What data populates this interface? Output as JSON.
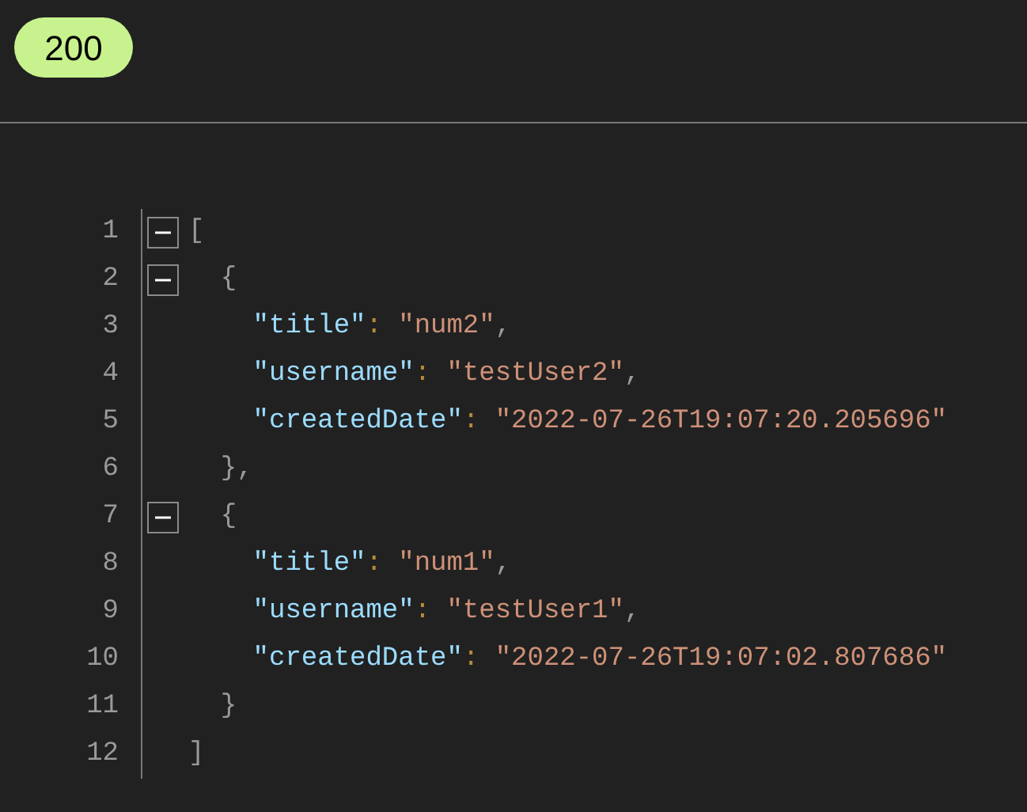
{
  "status": "200",
  "lines": [
    {
      "number": "1",
      "expanded": true,
      "tokens": [
        {
          "kind": "punct",
          "text": "["
        }
      ]
    },
    {
      "number": "2",
      "expanded": true,
      "tokens": [
        {
          "kind": "punct",
          "text": "  {"
        }
      ]
    },
    {
      "number": "3",
      "tokens": [
        {
          "kind": "key",
          "text": "    \"title\""
        },
        {
          "kind": "colon",
          "text": ": "
        },
        {
          "kind": "string",
          "text": "\"num2\""
        },
        {
          "kind": "punct",
          "text": ","
        }
      ]
    },
    {
      "number": "4",
      "tokens": [
        {
          "kind": "key",
          "text": "    \"username\""
        },
        {
          "kind": "colon",
          "text": ": "
        },
        {
          "kind": "string",
          "text": "\"testUser2\""
        },
        {
          "kind": "punct",
          "text": ","
        }
      ]
    },
    {
      "number": "5",
      "tokens": [
        {
          "kind": "key",
          "text": "    \"createdDate\""
        },
        {
          "kind": "colon",
          "text": ": "
        },
        {
          "kind": "string",
          "text": "\"2022-07-26T19:07:20.205696\""
        }
      ]
    },
    {
      "number": "6",
      "tokens": [
        {
          "kind": "punct",
          "text": "  },"
        }
      ]
    },
    {
      "number": "7",
      "expanded": true,
      "tokens": [
        {
          "kind": "punct",
          "text": "  {"
        }
      ]
    },
    {
      "number": "8",
      "tokens": [
        {
          "kind": "key",
          "text": "    \"title\""
        },
        {
          "kind": "colon",
          "text": ": "
        },
        {
          "kind": "string",
          "text": "\"num1\""
        },
        {
          "kind": "punct",
          "text": ","
        }
      ]
    },
    {
      "number": "9",
      "tokens": [
        {
          "kind": "key",
          "text": "    \"username\""
        },
        {
          "kind": "colon",
          "text": ": "
        },
        {
          "kind": "string",
          "text": "\"testUser1\""
        },
        {
          "kind": "punct",
          "text": ","
        }
      ]
    },
    {
      "number": "10",
      "tokens": [
        {
          "kind": "key",
          "text": "    \"createdDate\""
        },
        {
          "kind": "colon",
          "text": ": "
        },
        {
          "kind": "string",
          "text": "\"2022-07-26T19:07:02.807686\""
        }
      ]
    },
    {
      "number": "11",
      "tokens": [
        {
          "kind": "punct",
          "text": "  }"
        }
      ]
    },
    {
      "number": "12",
      "tokens": [
        {
          "kind": "punct",
          "text": "]"
        }
      ]
    }
  ]
}
